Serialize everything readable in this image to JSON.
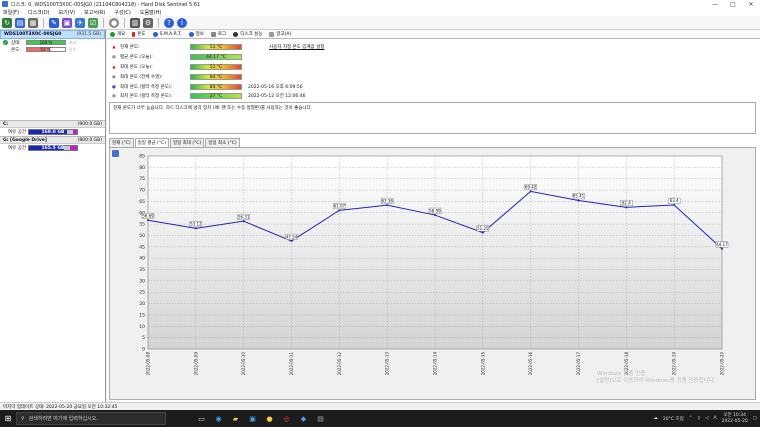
{
  "window": {
    "title": "디스크: 0, WDS100T3X0C-00SJG0 (21104C804218) - Hard Disk Sentinel 5.61",
    "controls": [
      "—",
      "□",
      "✕"
    ]
  },
  "menu": [
    "파일(F)",
    "디스크(D)",
    "보기(V)",
    "보고서(R)",
    "구성(C)",
    "도움말(H)"
  ],
  "disk": {
    "name": "WDS100T3X0C-00SJG0",
    "capacity": "(931.5 GB)",
    "health_label": "상태:",
    "health_value": "100 %",
    "health_pct": 100,
    "health_extra": "최고",
    "health_extra2": "우수",
    "temp_label": "온도:",
    "temp_value": "51 °C",
    "temp_pct": 60,
    "colors": {
      "health": "#3ecb4c",
      "temp": "#ee6a6a"
    }
  },
  "volumes": [
    {
      "drive": "C:",
      "capacity": "(900.0 GB)",
      "free_label": "여유 공간",
      "free_value": "169.0 GB",
      "used_pct": 80,
      "other_pct": 8
    },
    {
      "drive": "G: [Google Drive]",
      "capacity": "(800.0 GB)",
      "free_label": "여유 공간",
      "free_value": "165.5 GB",
      "used_pct": 72,
      "other_pct": 15
    }
  ],
  "tabs": [
    {
      "label": "개요",
      "icon": "check-circle-icon",
      "color": "#1e9b2e"
    },
    {
      "label": "온도",
      "icon": "thermometer-icon",
      "color": "#d22"
    },
    {
      "label": "S.M.A.R.T.",
      "icon": "smart-icon",
      "color": "#2b5fd1"
    },
    {
      "label": "정보",
      "icon": "info-icon",
      "color": "#2b5fd1"
    },
    {
      "label": "로그",
      "icon": "log-icon",
      "color": "#888"
    },
    {
      "label": "디스크 성능",
      "icon": "performance-icon",
      "color": "#333"
    },
    {
      "label": "알고(A)",
      "icon": "alert-icon",
      "color": "#999"
    }
  ],
  "temps": [
    {
      "icon": "warning-icon",
      "label": "현재 온도:",
      "value": "51 °C",
      "timestamp": ""
    },
    {
      "icon": "info-gray-icon",
      "label": "평균 온도 (오늘):",
      "value": "44.17 °C",
      "timestamp": ""
    },
    {
      "icon": "warning-icon",
      "label": "최대 온도 (오늘):",
      "value": "51 °C",
      "timestamp": ""
    },
    {
      "icon": "info-gray-icon",
      "label": "최대 온도 (전체 수명):",
      "value": "84 °C",
      "timestamp": ""
    },
    {
      "icon": "info-blue-icon",
      "label": "최대 온도 (힐터 측정 온도):",
      "value": "84 °C",
      "timestamp": "2022-05-16 오후 6:09:56"
    },
    {
      "icon": "info-gray-icon",
      "label": "최저 온도 (힐터 측정 온도):",
      "value": "27 °C",
      "timestamp": "2022-05-12 오전 12:06:46"
    }
  ],
  "settings_link": "사용자 지정 온도 임계값 설정",
  "message": "현재 온도가 너무 높습니다. 하드 디스크에 냉각 장치 (예: 팬 또는 수동 방열판)를 사용하는 것이 좋습니다.",
  "subtabs": [
    "현재 (°C)",
    "일일 평균 (°C)",
    "일일 최대 (°C)",
    "일일 최소 (°C)"
  ],
  "active_subtab": 1,
  "chart_data": {
    "type": "line",
    "title": "",
    "xlabel": "",
    "ylabel": "",
    "ylim": [
      0,
      85
    ],
    "yticks": [
      0,
      5,
      10,
      15,
      20,
      25,
      30,
      35,
      40,
      45,
      50,
      55,
      60,
      65,
      70,
      75,
      80,
      85
    ],
    "grid": true,
    "x": [
      "2022-05-08",
      "2022-05-09",
      "2022-05-10",
      "2022-05-11",
      "2022-05-12",
      "2022-05-13",
      "2022-05-14",
      "2022-05-15",
      "2022-05-16",
      "2022-05-17",
      "2022-05-18",
      "2022-05-19",
      "2022-05-20"
    ],
    "values": [
      56.69,
      53.12,
      56.31,
      47.54,
      61.07,
      63.36,
      58.99,
      51.25,
      69.42,
      65.41,
      62.4,
      63.4,
      44.17
    ],
    "data_labels": [
      "56.69",
      "53.12",
      "56.31",
      "47.54",
      "61.07",
      "63.36",
      "58.99",
      "51.25",
      "69.42",
      "65.41",
      "62.4",
      "63.4",
      "44.17"
    ],
    "colors": {
      "line": "#1a28b8",
      "grid": "#9a9a9a",
      "plot_bg_top": "#ffffff",
      "plot_bg_bottom": "#d4d4d4"
    }
  },
  "statusbar": "마지막 업데이트 상태: 2022-05-20 금요일 오전 10:32:45",
  "watermark": [
    "Windows 정품 인증",
    "[설정]으로 이동하여 Windows를 정품 인증합니다."
  ],
  "taskbar": {
    "search_placeholder": "검색하려면 여기에 입력하십시오.",
    "weather": "20°C 흐림",
    "ime": "A",
    "time": "오전 10:34",
    "date": "2022-05-20"
  }
}
